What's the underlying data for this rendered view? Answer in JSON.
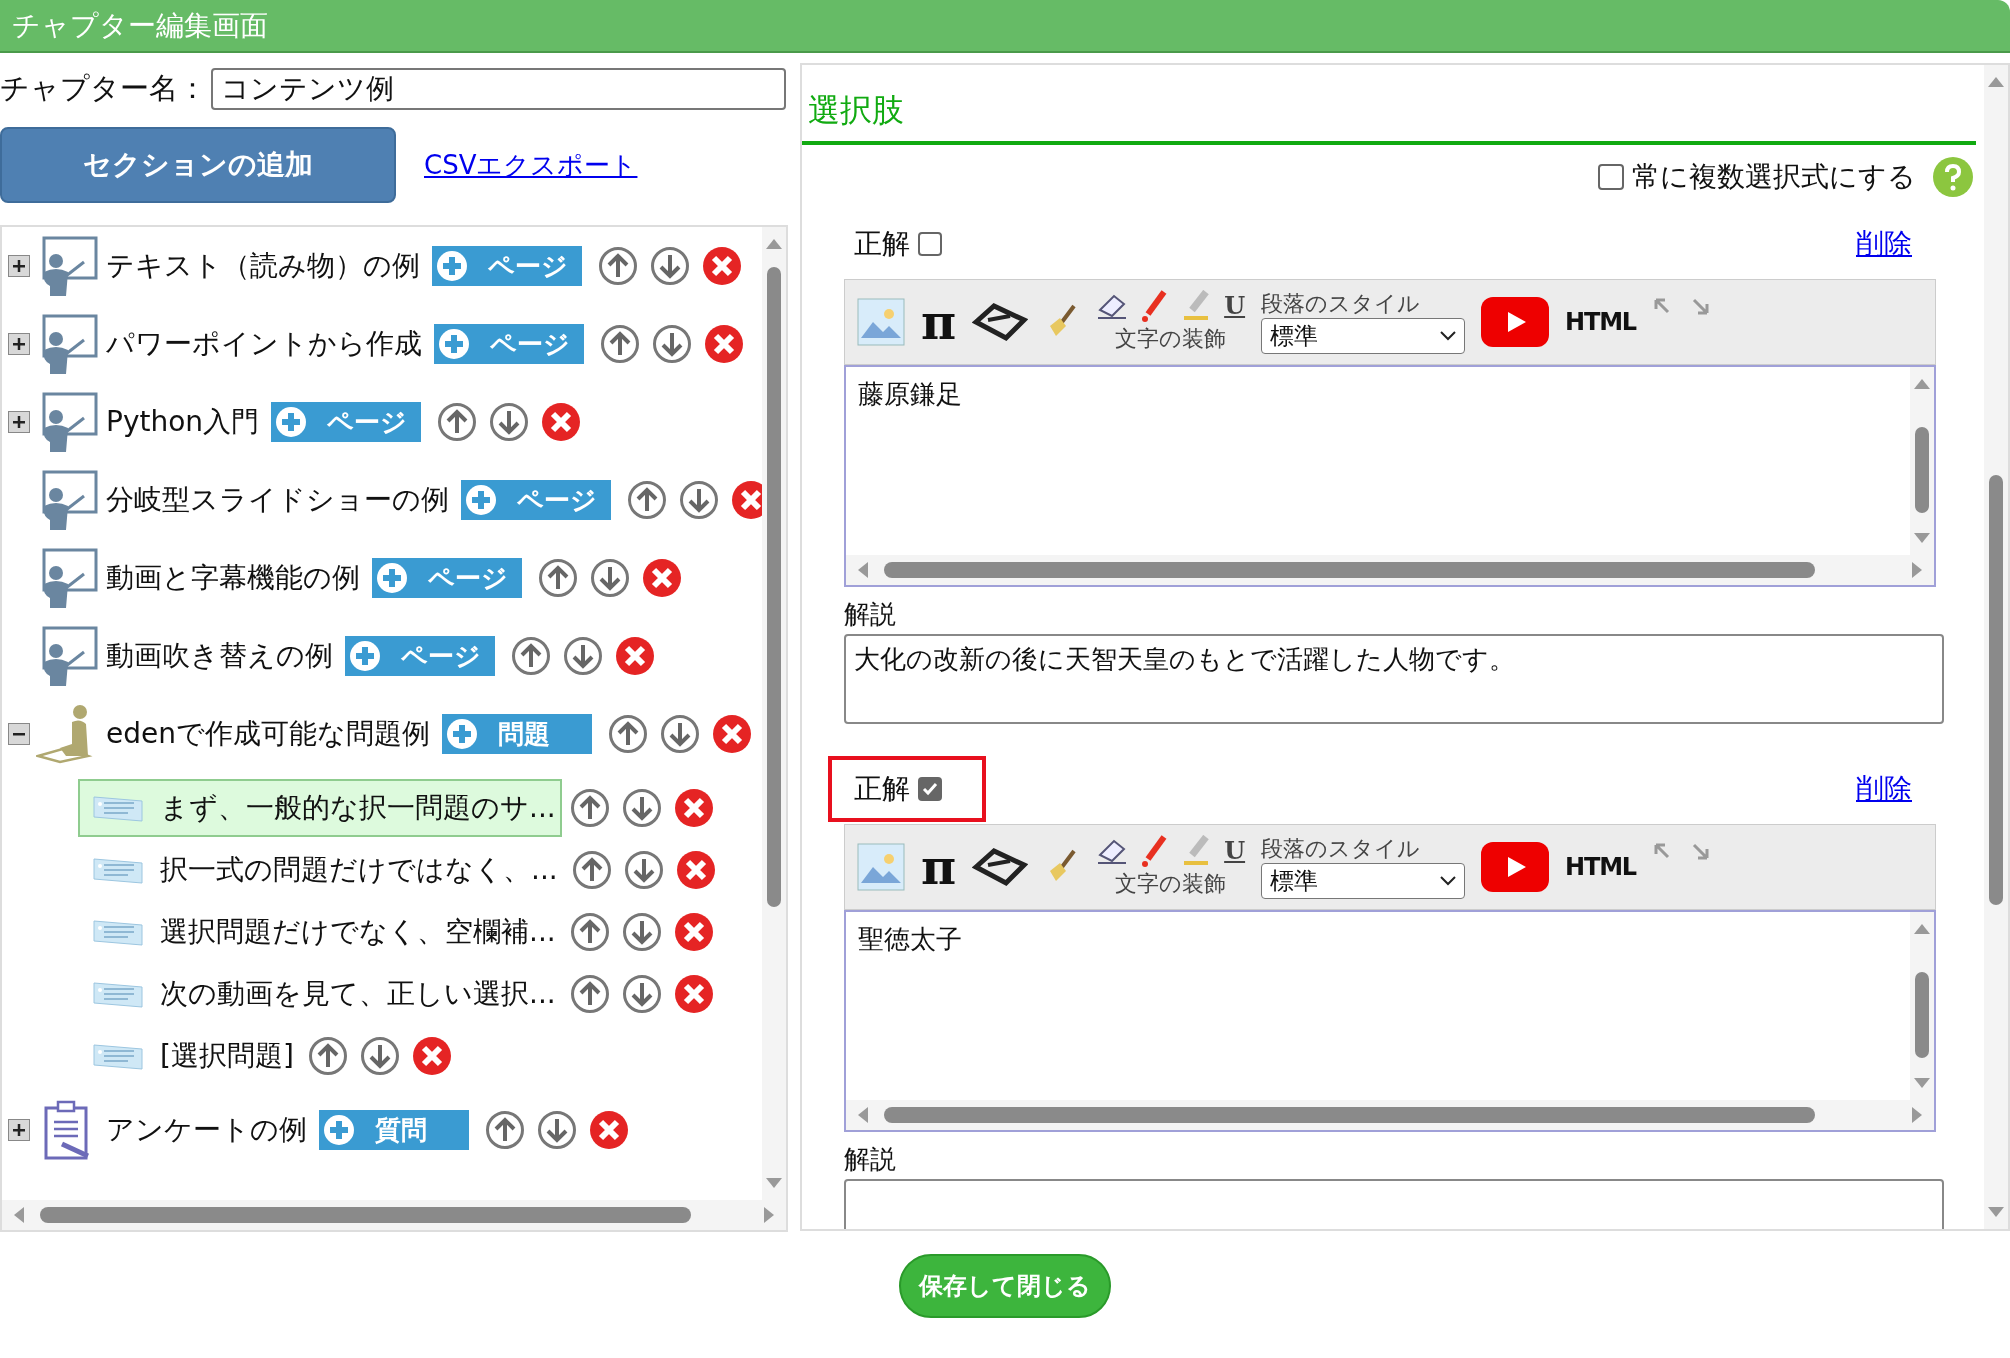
{
  "window": {
    "title": "チャプター編集画面"
  },
  "chapter_name": {
    "label": "チャプター名：",
    "value": "コンテンツ例"
  },
  "add_section_button": "セクションの追加",
  "csv_export_link": "CSVエクスポート",
  "tree": [
    {
      "kind": "slides",
      "label": "テキスト（読み物）の例",
      "add_button": "ページ",
      "expanded": false
    },
    {
      "kind": "slides",
      "label": "パワーポイントから作成",
      "add_button": "ページ",
      "expanded": false
    },
    {
      "kind": "slides",
      "label": "Python入門",
      "add_button": "ページ",
      "expanded": false
    },
    {
      "kind": "slides",
      "label": "分岐型スライドショーの例",
      "add_button": "ページ"
    },
    {
      "kind": "slides",
      "label": "動画と字幕機能の例",
      "add_button": "ページ"
    },
    {
      "kind": "slides",
      "label": "動画吹き替えの例",
      "add_button": "ページ"
    },
    {
      "kind": "quiz",
      "label": "edenで作成可能な問題例",
      "add_button": "問題",
      "expanded": true,
      "children": [
        {
          "label": "まず、一般的な択一問題のサ...",
          "selected": true
        },
        {
          "label": "択一式の問題だけではなく、...",
          "selected": false
        },
        {
          "label": "選択問題だけでなく、空欄補...",
          "selected": false
        },
        {
          "label": "次の動画を見て、正しい選択...",
          "selected": false
        },
        {
          "label": "[選択問題]",
          "selected": false
        }
      ]
    },
    {
      "kind": "survey",
      "label": "アンケートの例",
      "add_button": "質問",
      "expanded": false
    }
  ],
  "choices_section": {
    "title": "選択肢",
    "multi_select": {
      "label": "常に複数選択式にする",
      "checked": false
    },
    "choices": [
      {
        "correct_label": "正解",
        "correct": false,
        "highlighted": false,
        "delete_link": "削除",
        "toolbar": {
          "pi": "π",
          "underline": "U",
          "decoration_label": "文字の装飾",
          "style_label": "段落のスタイル",
          "style_value": "標準",
          "html": "HTML"
        },
        "text": "藤原鎌足",
        "explanation_label": "解説",
        "explanation": "大化の改新の後に天智天皇のもとで活躍した人物です。"
      },
      {
        "correct_label": "正解",
        "correct": true,
        "highlighted": true,
        "delete_link": "削除",
        "toolbar": {
          "pi": "π",
          "underline": "U",
          "decoration_label": "文字の装飾",
          "style_label": "段落のスタイル",
          "style_value": "標準",
          "html": "HTML"
        },
        "text": "聖徳太子",
        "explanation_label": "解説"
      }
    ]
  },
  "save_button": "保存して閉じる"
}
